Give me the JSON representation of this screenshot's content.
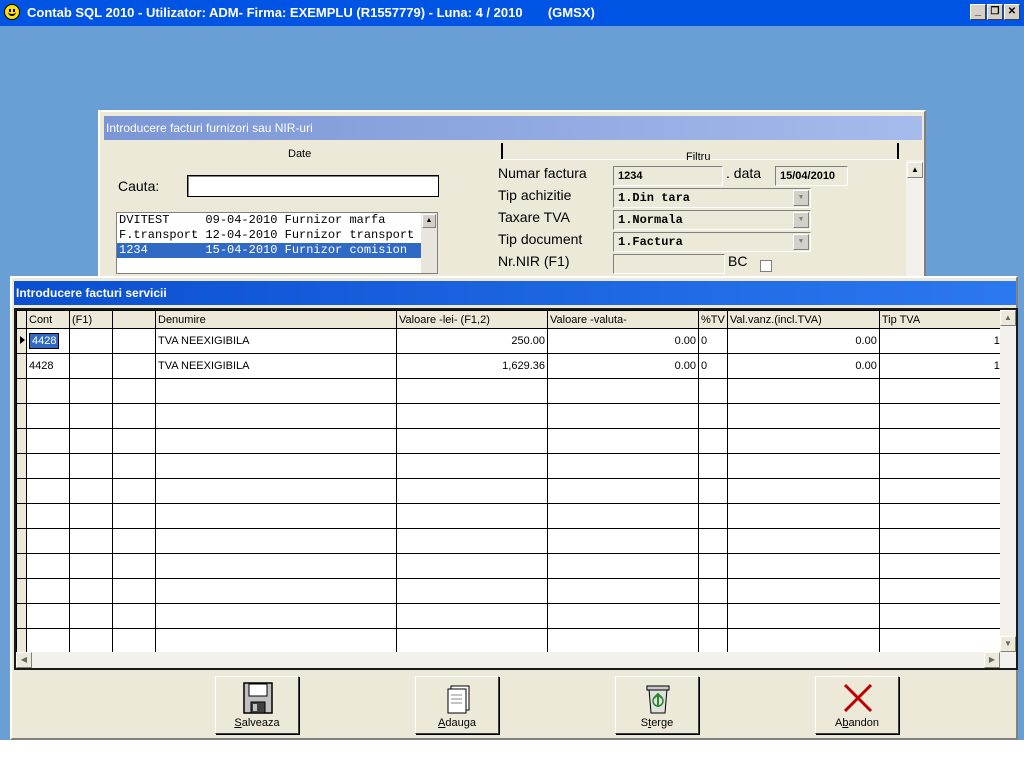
{
  "app": {
    "title": "Contab SQL 2010 - Utilizator: ADM- Firma: EXEMPLU (R1557779) - Luna: 4 / 2010       (GMSX)",
    "controls": {
      "minimize": "_",
      "restore": "❐",
      "close": "✕"
    }
  },
  "nir_dialog": {
    "title": "Introducere facturi furnizori sau NIR-uri",
    "tab_date": "Date",
    "tab_filtru": "Filtru",
    "search_label": "Cauta:",
    "search_value": "",
    "suppliers": [
      {
        "text": "DVITEST     09-04-2010 Furnizor marfa",
        "selected": false
      },
      {
        "text": "F.transport 12-04-2010 Furnizor transport",
        "selected": false
      },
      {
        "text": "1234        15-04-2010 Furnizor comision",
        "selected": true
      }
    ],
    "numar_factura_label": "Numar factura",
    "numar_factura_value": "1234",
    "data_label": ". data",
    "data_value": "15/04/2010",
    "tip_achizitie_label": "Tip achizitie",
    "tip_achizitie_value": "1.Din tara",
    "taxare_tva_label": "Taxare TVA",
    "taxare_tva_value": "1.Normala",
    "tip_document_label": "Tip document",
    "tip_document_value": "1.Factura",
    "nr_nir_label": "Nr.NIR (F1)",
    "nr_nir_value": "",
    "bc_label": "BC"
  },
  "servicii_dialog": {
    "title": "Introducere facturi servicii",
    "columns": [
      "Cont",
      "(F1)",
      "",
      "Denumire",
      "Valoare -lei- (F1,2)",
      "Valoare -valuta-",
      "%TV",
      "Val.vanz.(incl.TVA)",
      "Tip TVA"
    ],
    "rows": [
      {
        "cont": "4428",
        "f1": "",
        "extra": "",
        "denumire": "TVA NEEXIGIBILA",
        "valoare_lei": "250.00",
        "valoare_valuta": "0.00",
        "tva_pct": "0",
        "val_vanz": "0.00",
        "tip_tva": "1"
      },
      {
        "cont": "4428",
        "f1": "",
        "extra": "",
        "denumire": "TVA NEEXIGIBILA",
        "valoare_lei": "1,629.36",
        "valoare_valuta": "0.00",
        "tva_pct": "0",
        "val_vanz": "0.00",
        "tip_tva": "1"
      }
    ],
    "buttons": {
      "save": {
        "underline": "S",
        "rest": "alveaza",
        "icon": "floppy-disk-icon"
      },
      "add": {
        "underline": "A",
        "rest": "dauga",
        "icon": "new-document-icon"
      },
      "delete": {
        "pre": "S",
        "underline": "t",
        "rest": "erge",
        "icon": "recycle-bin-icon"
      },
      "abandon": {
        "pre": "A",
        "underline": "b",
        "rest": "andon",
        "icon": "red-x-icon"
      }
    }
  },
  "colors": {
    "desktop": "#6a9fd6",
    "titlebar": "#0054e3",
    "selection": "#316ac5",
    "dialog_face": "#ece9d8"
  }
}
